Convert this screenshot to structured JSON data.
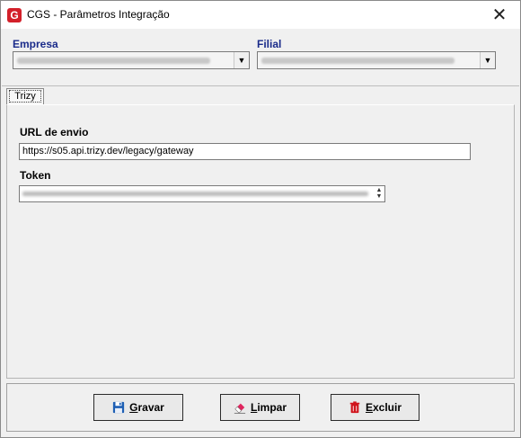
{
  "window": {
    "title": "CGS - Parâmetros Integração",
    "close_glyph": "✕",
    "app_icon_letter": "G"
  },
  "filters": {
    "empresa_label": "Empresa",
    "filial_label": "Filial"
  },
  "tabs": [
    {
      "label": "Trizy"
    }
  ],
  "form": {
    "url_label": "URL de envio",
    "url_value": "https://s05.api.trizy.dev/legacy/gateway",
    "token_label": "Token"
  },
  "buttons": {
    "save": {
      "first": "G",
      "rest": "ravar"
    },
    "clear": {
      "first": "L",
      "rest": "impar"
    },
    "delete": {
      "first": "E",
      "rest": "xcluir"
    }
  },
  "icons": {
    "app": "cgs-logo-icon",
    "save": "floppy-disk-icon",
    "clear": "eraser-icon",
    "delete": "trash-icon"
  },
  "colors": {
    "label_blue": "#1a2b8a",
    "app_red": "#d3202a",
    "save_blue": "#1e5fb4",
    "delete_red": "#d0141c"
  }
}
